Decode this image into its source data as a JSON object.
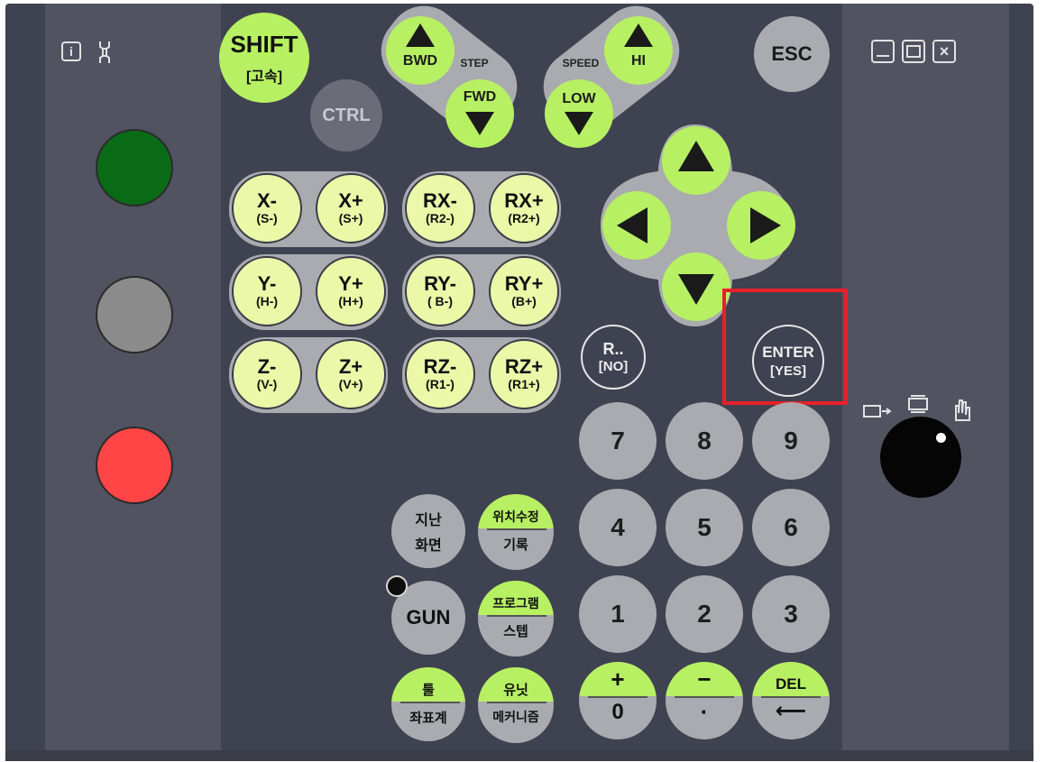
{
  "left": {
    "info_icon_label": "i",
    "wrench_icon": "wrench-icon",
    "lamps": [
      {
        "name": "green",
        "color": "#0a6b16"
      },
      {
        "name": "gray",
        "color": "#8b8b8b"
      },
      {
        "name": "red",
        "color": "#ff4545"
      }
    ]
  },
  "top_keys": {
    "shift": "SHIFT",
    "shift_sub": "[고속]",
    "ctrl": "CTRL",
    "bwd": "BWD",
    "fwd": "FWD",
    "step": "STEP",
    "speed": "SPEED",
    "hi": "HI",
    "low": "LOW",
    "esc": "ESC"
  },
  "axis_keys": [
    {
      "main": "X-",
      "sub": "(S-)"
    },
    {
      "main": "X+",
      "sub": "(S+)"
    },
    {
      "main": "RX-",
      "sub": "(R2-)"
    },
    {
      "main": "RX+",
      "sub": "(R2+)"
    },
    {
      "main": "Y-",
      "sub": "(H-)"
    },
    {
      "main": "Y+",
      "sub": "(H+)"
    },
    {
      "main": "RY-",
      "sub": "( B-)"
    },
    {
      "main": "RY+",
      "sub": "(B+)"
    },
    {
      "main": "Z-",
      "sub": "(V-)"
    },
    {
      "main": "Z+",
      "sub": "(V+)"
    },
    {
      "main": "RZ-",
      "sub": "(R1-)"
    },
    {
      "main": "RZ+",
      "sub": "(R1+)"
    }
  ],
  "r_key": {
    "main": "R..",
    "sub": "[NO]"
  },
  "enter_key": {
    "main": "ENTER",
    "sub": "[YES]"
  },
  "numpad": [
    "7",
    "8",
    "9",
    "4",
    "5",
    "6",
    "1",
    "2",
    "3"
  ],
  "func_keys": {
    "prev_screen_1": "지난",
    "prev_screen_2": "화면",
    "pos_edit_top": "위치수정",
    "pos_edit_bot": "기록",
    "gun": "GUN",
    "program_top": "프로그램",
    "program_bot": "스텝",
    "tool_top": "툴",
    "tool_bot": "좌표계",
    "unit_top": "유닛",
    "unit_bot": "메커니즘",
    "plus_top": "+",
    "plus_bot": "0",
    "minus_top": "−",
    "minus_bot": "·",
    "del_top": "DEL",
    "del_bot": "⟵"
  },
  "colors": {
    "accent_green": "#b7f062",
    "key_gray": "#a9abb0",
    "panel_dark": "#3f4250",
    "highlight_red": "#e8202a"
  }
}
